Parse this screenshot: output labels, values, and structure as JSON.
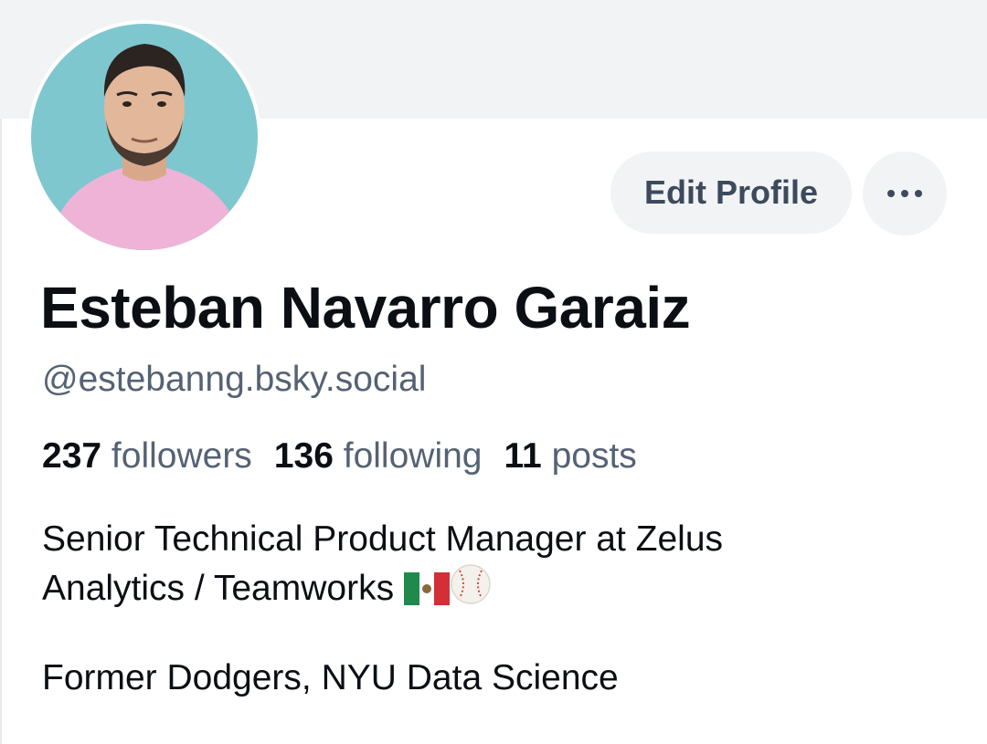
{
  "profile": {
    "display_name": "Esteban Navarro Garaiz",
    "handle": "@estebanng.bsky.social",
    "avatar_icon": "profile-photo"
  },
  "actions": {
    "edit_label": "Edit Profile",
    "more_icon": "ellipsis-icon"
  },
  "stats": {
    "followers_count": "237",
    "followers_label": "followers",
    "following_count": "136",
    "following_label": "following",
    "posts_count": "11",
    "posts_label": "posts"
  },
  "bio": {
    "line1": "Senior Technical Product Manager at Zelus",
    "line2": "Analytics / Teamworks",
    "emojis": [
      "mexico-flag-icon",
      "baseball-icon"
    ],
    "line3": "Former Dodgers, NYU Data Science"
  },
  "colors": {
    "banner": "#f1f3f5",
    "button_bg": "#f1f3f5",
    "button_text": "#3d4a5c",
    "secondary_text": "#556273",
    "primary_text": "#0b0f14"
  }
}
